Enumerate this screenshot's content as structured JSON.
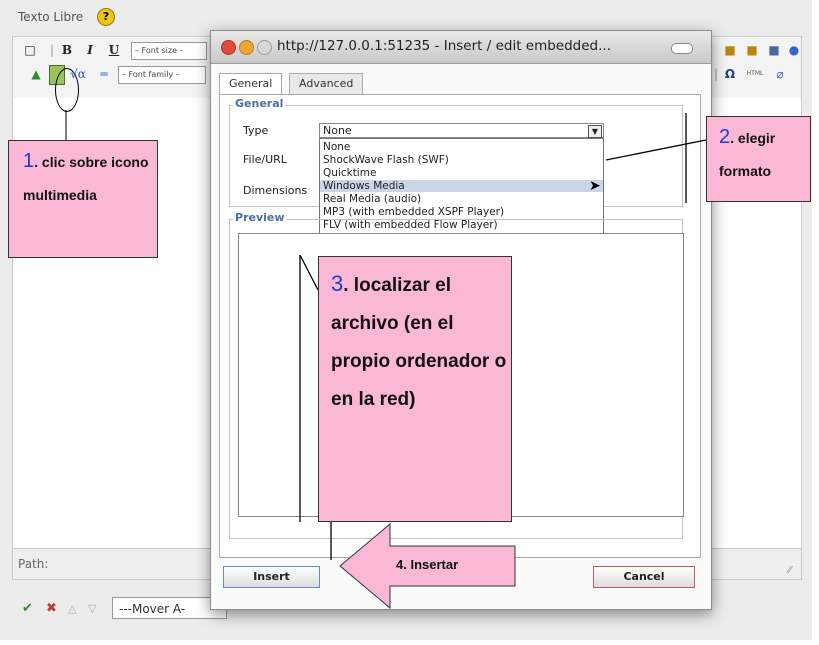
{
  "editor": {
    "field_title": "Texto Libre",
    "help_icon": "?",
    "toolbar": {
      "bold": "B",
      "italic": "I",
      "underline": "U",
      "font_size": "– Font size –",
      "font_family": "– Font family –",
      "omega": "Ω",
      "html": "HTML"
    },
    "path_label": "Path:",
    "mover_select": "---Mover A-",
    "icons": [
      "new-doc-icon",
      "bold-icon",
      "italic-icon",
      "underline-icon",
      "image-icon",
      "media-icon",
      "math-icon",
      "hr-icon",
      "paste-icon",
      "paste-text-icon",
      "paste-word-icon",
      "help-icon",
      "omega-icon",
      "html-icon",
      "cleanup-icon",
      "check-icon",
      "delete-icon",
      "up-icon",
      "down-icon"
    ]
  },
  "dialog": {
    "title": "http://127.0.0.1:51235 - Insert / edit embedded...",
    "tabs": [
      "General",
      "Advanced"
    ],
    "active_tab": "General",
    "general_legend": "General",
    "type_label": "Type",
    "type_value": "None",
    "file_label": "File/URL",
    "dimensions_label": "Dimensions",
    "preview_legend": "Preview",
    "type_options": [
      "None",
      "ShockWave Flash (SWF)",
      "Quicktime",
      "Windows Media",
      "Real Media (audio)",
      "MP3 (with embedded XSPF Player)",
      "FLV (with embedded Flow Player)"
    ],
    "highlighted_option": "Windows Media",
    "insert_label": "Insert",
    "cancel_label": "Cancel"
  },
  "annotations": {
    "step1_num": "1",
    "step1_text": ". clic sobre icono multimedia",
    "step2_num": "2",
    "step2_text": ". elegir formato",
    "step3_num": "3",
    "step3_text": ". localizar el archivo (en el propio ordenador o en la red)",
    "step4_text": "4. Insertar"
  },
  "colors": {
    "callout_pink": "#fbb7d6",
    "step_number_blue": "#1a3fcc",
    "legend_blue": "#4f6da3",
    "cancel_border": "#c85757",
    "insert_border": "#6c89c3"
  }
}
